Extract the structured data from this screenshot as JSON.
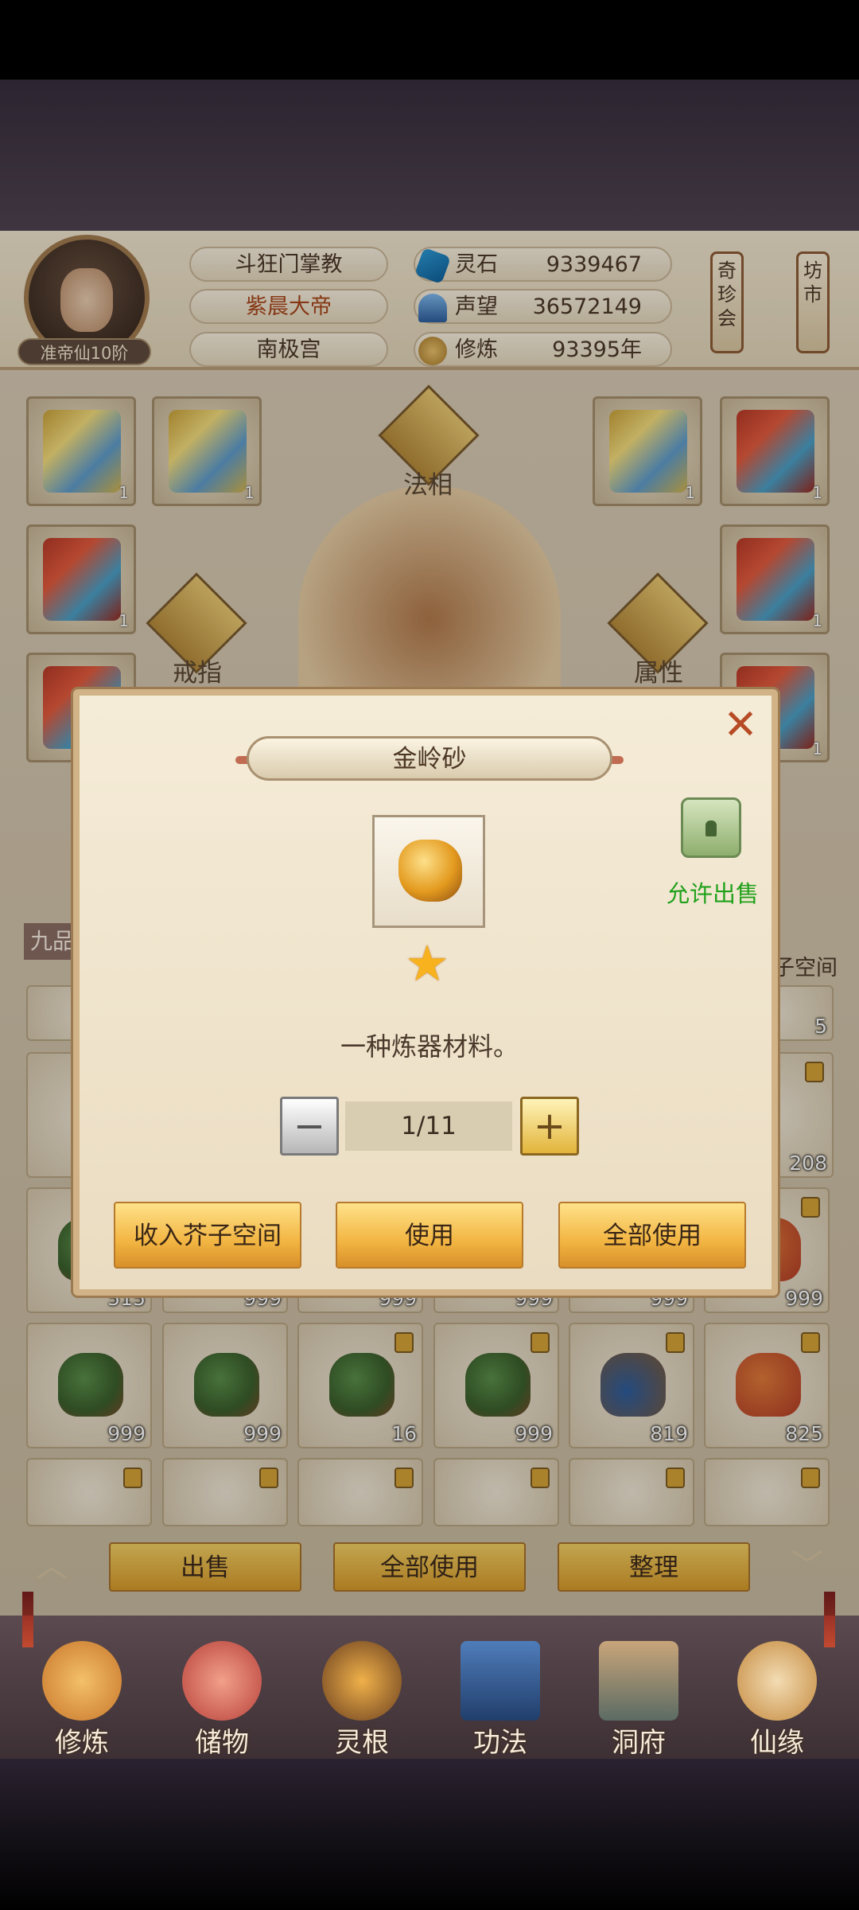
{
  "player": {
    "rank": "准帝仙10阶",
    "titles": [
      "斗狂门掌教",
      "紫晨大帝",
      "南极宫"
    ]
  },
  "stats": [
    {
      "icon": "spirit-stone-icon",
      "label": "灵石",
      "value": "9339467"
    },
    {
      "icon": "prestige-icon",
      "label": "声望",
      "value": "36572149"
    },
    {
      "icon": "cultivation-icon",
      "label": "修炼",
      "value": "93395年"
    }
  ],
  "side_buttons": [
    {
      "label": "奇珍会"
    },
    {
      "label": "坊市"
    }
  ],
  "equipment": {
    "slot_labels": {
      "fa_xiang": "法相",
      "ring": "戒指",
      "attribute": "属性"
    },
    "tier_tag": "九品",
    "space_label": "子空间",
    "counts": [
      "1",
      "1",
      "1",
      "1",
      "1",
      "1",
      "1",
      "1"
    ]
  },
  "inventory": {
    "row1_counts": [
      "5"
    ],
    "row2_counts": [
      "208"
    ],
    "row3_counts": [
      "515",
      "999",
      "999",
      "999",
      "999",
      "999"
    ],
    "row4_counts": [
      "999",
      "999",
      "16",
      "999",
      "819",
      "825"
    ]
  },
  "bottom_actions": {
    "sell": "出售",
    "use_all": "全部使用",
    "sort": "整理"
  },
  "nav": [
    {
      "label": "修炼",
      "icon": "cultivate-nav-icon"
    },
    {
      "label": "储物",
      "icon": "storage-nav-icon"
    },
    {
      "label": "灵根",
      "icon": "spirit-root-nav-icon"
    },
    {
      "label": "功法",
      "icon": "technique-nav-icon"
    },
    {
      "label": "洞府",
      "icon": "cave-nav-icon"
    },
    {
      "label": "仙缘",
      "icon": "destiny-nav-icon"
    }
  ],
  "dialog": {
    "title": "金岭砂",
    "sale_status": "允许出售",
    "description": "一种炼器材料。",
    "quantity": "1/11",
    "stars": 1,
    "buttons": {
      "store": "收入芥子空间",
      "use": "使用",
      "use_all": "全部使用"
    }
  },
  "colors": {
    "accent_gold": "#f2b542",
    "sale_green": "#20a11c",
    "close_red": "#b64b25"
  }
}
